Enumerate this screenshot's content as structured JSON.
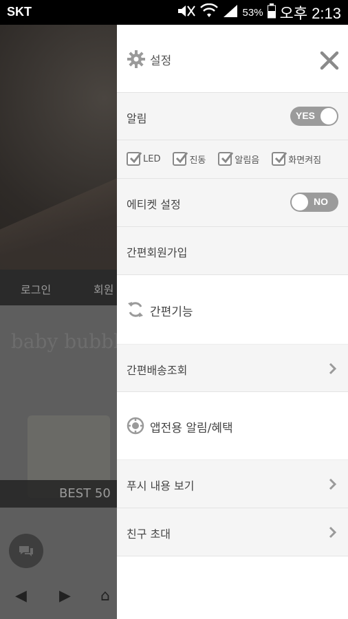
{
  "status_bar": {
    "carrier": "SKT",
    "battery": "53%",
    "time": "오후 2:13"
  },
  "background": {
    "nav": [
      "로그인",
      "회원"
    ],
    "brand": "baby bubbl",
    "best_label": "BEST 50"
  },
  "drawer": {
    "title": "설정",
    "alarm": {
      "label": "알림",
      "toggle": "YES"
    },
    "checks": [
      {
        "label": "LED"
      },
      {
        "label": "진동"
      },
      {
        "label": "알림음"
      },
      {
        "label": "화면켜짐"
      }
    ],
    "etiquette": {
      "label": "에티켓 설정",
      "toggle": "NO"
    },
    "signup": "간편회원가입",
    "quick_section": "간편기능",
    "delivery": "간편배송조회",
    "app_section": "앱전용 알림/혜택",
    "push": "푸시 내용 보기",
    "invite": "친구 초대"
  },
  "icons": {
    "settings": "gear-icon",
    "close": "close-icon",
    "refresh": "refresh-icon",
    "target": "target-icon",
    "chevron": "chevron-right-icon"
  },
  "colors": {
    "toggle": "#9b9b9b",
    "drawer_row": "#f5f5f5",
    "accent_gray": "#888888"
  }
}
